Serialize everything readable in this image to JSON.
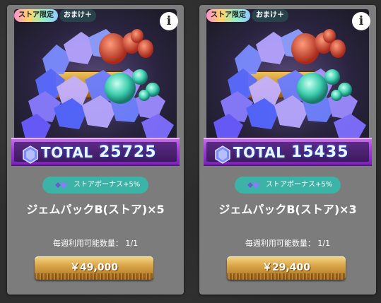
{
  "colors": {
    "card_bg": "#7c7c7c",
    "store_bonus_bg": "#3bb3a6",
    "banner_purple": "#a03ad6",
    "price_gold": "#d9a548",
    "bonus_badge_bg": "#27424a"
  },
  "cards": [
    {
      "badge_store": "ストア限定",
      "badge_bonus": "おまけ＋",
      "info_icon": "i",
      "total_label": "TOTAL",
      "total_value": "25725",
      "store_bonus": "ストアボーナス+5%",
      "name": "ジェムパックB(ストア)×5",
      "weekly": "毎週利用可能数量： 1/1",
      "price": "￥49,000"
    },
    {
      "badge_store": "ストア限定",
      "badge_bonus": "おまけ＋",
      "info_icon": "i",
      "total_label": "TOTAL",
      "total_value": "15435",
      "store_bonus": "ストアボーナス+5%",
      "name": "ジェムパックB(ストア)×3",
      "weekly": "毎週利用可能数量： 1/1",
      "price": "￥29,400"
    }
  ]
}
